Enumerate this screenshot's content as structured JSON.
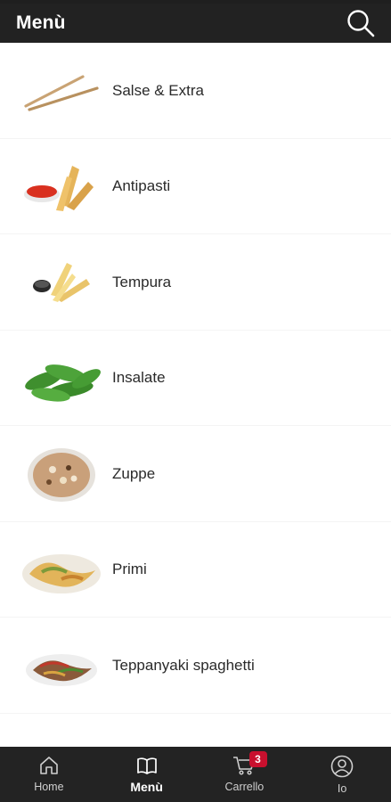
{
  "header": {
    "title": "Menù",
    "search_icon": "search-icon"
  },
  "categories": [
    {
      "label": "Salse & Extra",
      "icon": "chopsticks"
    },
    {
      "label": "Antipasti",
      "icon": "fried-shrimp-with-sauce"
    },
    {
      "label": "Tempura",
      "icon": "tempura-shrimp"
    },
    {
      "label": "Insalate",
      "icon": "edamame"
    },
    {
      "label": "Zuppe",
      "icon": "soup-bowl"
    },
    {
      "label": "Primi",
      "icon": "fried-noodles"
    },
    {
      "label": "Teppanyaki spaghetti",
      "icon": "teppanyaki-noodles"
    }
  ],
  "bottom_nav": {
    "home": {
      "label": "Home",
      "icon": "home-icon"
    },
    "menu": {
      "label": "Menù",
      "icon": "book-icon"
    },
    "cart": {
      "label": "Carrello",
      "icon": "cart-icon",
      "badge": "3"
    },
    "me": {
      "label": "Io",
      "icon": "user-icon"
    }
  },
  "colors": {
    "header_bg": "#222222",
    "nav_bg": "#232323",
    "badge": "#c8102e"
  }
}
